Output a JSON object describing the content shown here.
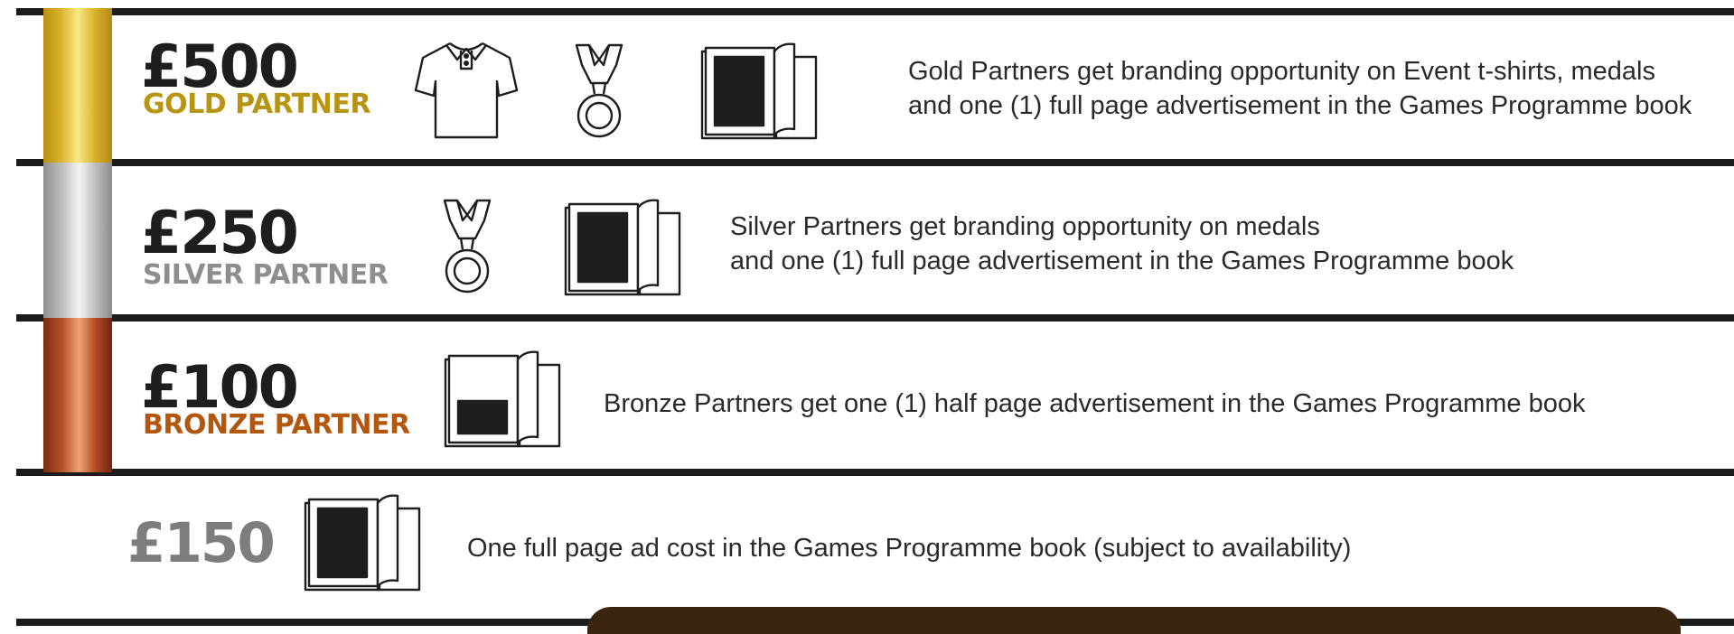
{
  "tiers": [
    {
      "price": "£500",
      "name": "GOLD PARTNER",
      "name_color": "#b79512",
      "desc_lines": [
        "Gold Partners get branding opportunity on Event t-shirts, medals",
        "and one (1) full page advertisement in the Games Programme book"
      ],
      "icons": [
        "t-shirt-icon",
        "medal-icon",
        "programme-book-full-page-icon"
      ]
    },
    {
      "price": "£250",
      "name": "SILVER PARTNER",
      "name_color": "#8e8e8e",
      "desc_lines": [
        "Silver Partners get branding opportunity on medals",
        "and one (1) full page advertisement in the Games Programme book"
      ],
      "icons": [
        "medal-icon",
        "programme-book-full-page-icon"
      ]
    },
    {
      "price": "£100",
      "name": "BRONZE PARTNER",
      "name_color": "#b3560e",
      "desc_lines": [
        "Bronze Partners get one (1) half page advertisement in the Games Programme book"
      ],
      "icons": [
        "programme-book-half-page-icon"
      ]
    }
  ],
  "ad_option": {
    "price": "£150",
    "price_color": "#7d7d7d",
    "desc": "One full page ad cost in the Games Programme book (subject to availability)",
    "icon": "programme-book-full-page-icon"
  }
}
